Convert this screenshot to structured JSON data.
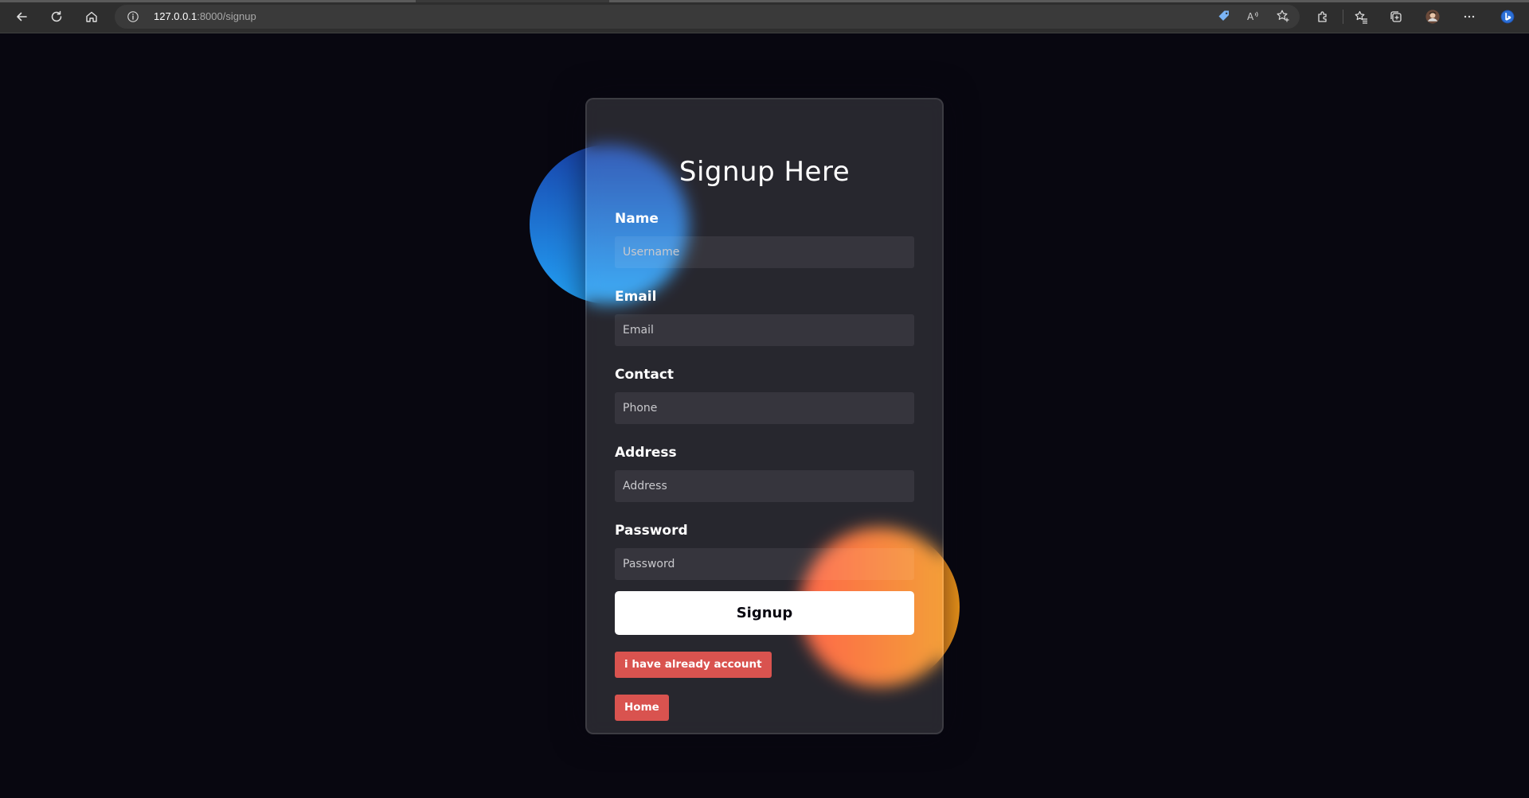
{
  "browser": {
    "url_host": "127.0.0.1",
    "url_rest": ":8000/signup",
    "icons": {
      "back": "back-arrow-icon",
      "reload": "reload-icon",
      "home": "home-icon",
      "info": "site-info-icon",
      "tag": "shopping-tag-icon",
      "read_aloud": "read-aloud-icon",
      "favorite_add": "add-favorite-icon",
      "extensions": "extensions-icon",
      "favorites": "favorites-icon",
      "collections": "collections-icon",
      "profile": "profile-avatar",
      "more": "more-icon",
      "bing": "bing-icon"
    }
  },
  "form": {
    "title": "Signup Here",
    "fields": [
      {
        "label": "Name",
        "placeholder": "Username"
      },
      {
        "label": "Email",
        "placeholder": "Email"
      },
      {
        "label": "Contact",
        "placeholder": "Phone"
      },
      {
        "label": "Address",
        "placeholder": "Address"
      },
      {
        "label": "Password",
        "placeholder": "Password"
      }
    ],
    "submit_label": "Signup",
    "login_link_label": "i have already account",
    "home_label": "Home"
  },
  "colors": {
    "page_background": "#080710",
    "blue_shape_gradient": [
      "#1845ad",
      "#23a2f6"
    ],
    "orange_shape_gradient": [
      "#ff512f",
      "#f09819"
    ],
    "submit_button": "#ffffff",
    "secondary_buttons": "#d9534f"
  }
}
